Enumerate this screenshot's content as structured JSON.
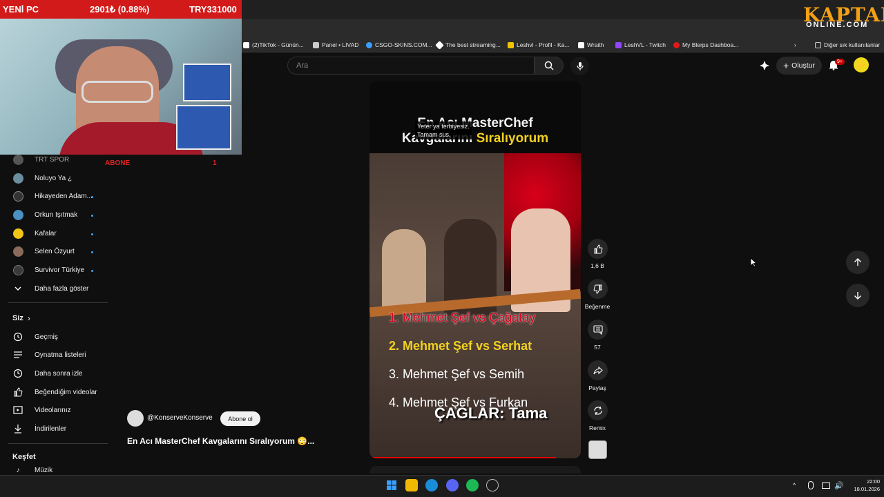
{
  "overlay": {
    "left_label": "YENİ PC",
    "center_label": "2901₺ (0.88%)",
    "right_label": "TRY331000",
    "subscribe_label": "ABONE",
    "subscribe_count": "1",
    "brand_top": "KAPTAN",
    "brand_bottom": "ONLINE.COM"
  },
  "bookmarks": {
    "items": [
      {
        "label": "(2)TikTok - Günün...",
        "color": "#ffffff"
      },
      {
        "label": "Panel • LIVAD",
        "color": "#cccccc"
      },
      {
        "label": "CSGO-SKINS.COM...",
        "color": "#3aa0ff"
      },
      {
        "label": "The best streaming...",
        "color": "#ffffff"
      },
      {
        "label": "Leshvl - Profil - Ka...",
        "color": "#f2c200"
      },
      {
        "label": "Wraith",
        "color": "#ffffff"
      },
      {
        "label": "LeshVL - Twitch",
        "color": "#9146ff"
      },
      {
        "label": "My Blerps Dashboa...",
        "color": "#e01a1a"
      }
    ],
    "other_folder": "Diğer sık kullanılanlar"
  },
  "header": {
    "search_placeholder": "Ara",
    "create_label": "Oluştur",
    "notification_count": "9+"
  },
  "sidebar": {
    "subscriptions": [
      {
        "label": "TRT SPOR",
        "color": "#555555",
        "live": false
      },
      {
        "label": "Noluyo Ya ¿",
        "color": "#6b8e9e",
        "live": false
      },
      {
        "label": "Hikayeden Adam...",
        "color": "#333333",
        "live": true
      },
      {
        "label": "Orkun Işıtmak",
        "color": "#4a90c0",
        "live": true
      },
      {
        "label": "Kafalar",
        "color": "#f0c419",
        "live": true
      },
      {
        "label": "Selen Özyurt",
        "color": "#8a6a5a",
        "live": true
      },
      {
        "label": "Survivor Türkiye",
        "color": "#3a3a3a",
        "live": true
      }
    ],
    "show_more": "Daha fazla göster",
    "you_section": "Siz",
    "you_items": [
      {
        "label": "Geçmiş",
        "icon": "history-icon"
      },
      {
        "label": "Oynatma listeleri",
        "icon": "playlist-icon"
      },
      {
        "label": "Daha sonra izle",
        "icon": "clock-icon"
      },
      {
        "label": "Beğendiğim videolar",
        "icon": "thumbs-up-icon"
      },
      {
        "label": "Videolarınız",
        "icon": "video-icon"
      },
      {
        "label": "İndirilenler",
        "icon": "download-icon"
      }
    ],
    "explore_section": "Keşfet",
    "explore_first": "Müzik"
  },
  "short": {
    "caption_line1": "Yeter ya terbiyesiz.",
    "caption_line2": "Tamam sus.",
    "title_line1": "En Acı MasterChef",
    "title_line2_white": "Kavgalarını ",
    "title_line2_yellow": "Sıralıyorum",
    "ranks": [
      {
        "text": "1. Mehmet Şef vs Çağatay",
        "color": "#d8001a"
      },
      {
        "text": "2. Mehmet Şef vs Serhat",
        "color": "#f1d11f"
      },
      {
        "text": "3. Mehmet Şef vs Semih",
        "color": "#ffffff"
      },
      {
        "text": "4. Mehmet Şef vs Furkan",
        "color": "#ffffff"
      }
    ],
    "subtitle_overlay": "ÇAĞLAR: Tama"
  },
  "actions": {
    "like_count": "1,6 B",
    "dislike_label": "Beğenme",
    "comment_count": "57",
    "share_label": "Paylaş",
    "remix_label": "Remix"
  },
  "channel": {
    "handle": "@KonserveKonserve",
    "subscribe_button": "Abone ol",
    "video_title": "En Acı MasterChef Kavgalarını Sıralıyorum 😳..."
  },
  "taskbar": {
    "time": "22:00",
    "date": "18.01.2026"
  },
  "colors": {
    "accent_red": "#d21a1a",
    "yt_bg": "#0f0f0f",
    "live_blue": "#3ea6ff"
  }
}
